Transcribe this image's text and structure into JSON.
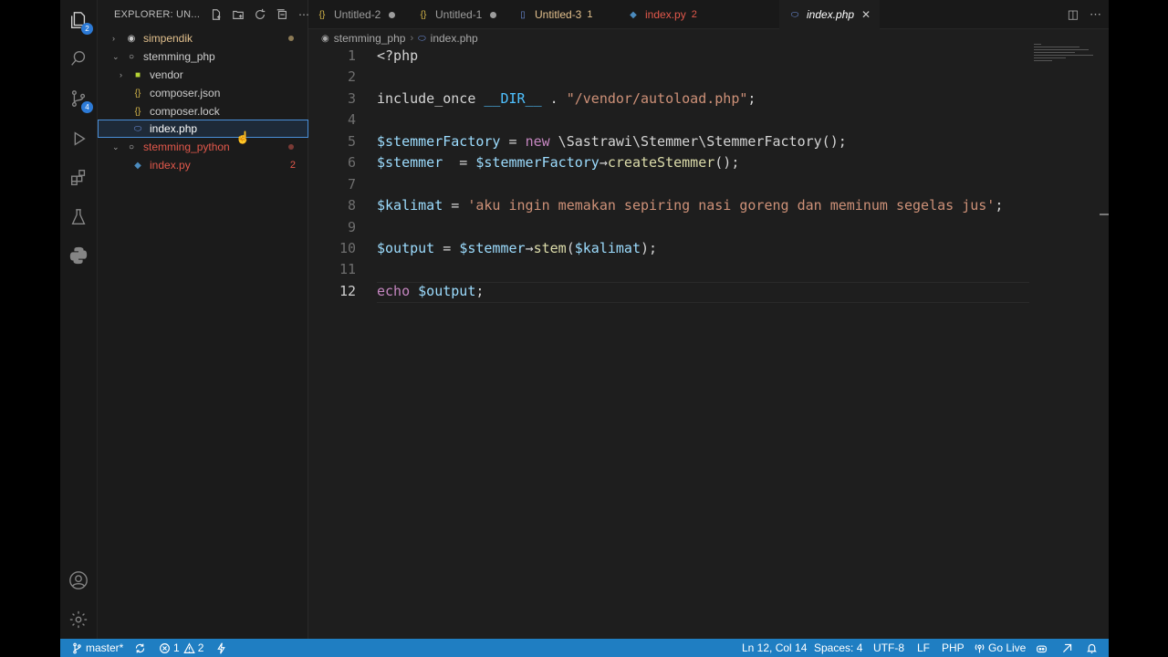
{
  "explorer": {
    "title": "EXPLORER: UN...",
    "items": [
      {
        "label": "simpendik",
        "type": "folder-root",
        "expanded": false,
        "color": "#e2c08d"
      },
      {
        "label": "stemming_php",
        "type": "folder-root",
        "expanded": true
      },
      {
        "label": "vendor",
        "type": "folder",
        "expanded": false
      },
      {
        "label": "composer.json",
        "type": "json"
      },
      {
        "label": "composer.lock",
        "type": "json"
      },
      {
        "label": "index.php",
        "type": "php",
        "selected": true
      },
      {
        "label": "stemming_python",
        "type": "folder-root",
        "expanded": true,
        "color": "#e2584b"
      },
      {
        "label": "index.py",
        "type": "python",
        "problems": "2",
        "color": "#e2584b"
      }
    ]
  },
  "tabs": [
    {
      "label": "Untitled-2",
      "icon": "json-icon",
      "modified": true
    },
    {
      "label": "Untitled-1",
      "icon": "json-icon",
      "modified": true
    },
    {
      "label": "Untitled-3",
      "count": "1",
      "icon": "file-icon",
      "color": "#e2c08d"
    },
    {
      "label": "index.py",
      "count": "2",
      "icon": "python-icon",
      "color": "#e2584b"
    },
    {
      "label": "index.php",
      "icon": "php-icon",
      "active": true
    }
  ],
  "breadcrumb": {
    "folder": "stemming_php",
    "file": "index.php"
  },
  "editor": {
    "line_numbers": [
      "1",
      "2",
      "3",
      "4",
      "5",
      "6",
      "7",
      "8",
      "9",
      "10",
      "11",
      "12"
    ],
    "current_line": "12"
  },
  "code": {
    "l1": "<?php",
    "l3a": "include_once ",
    "l3b": "__DIR__",
    "l3c": " . ",
    "l3d": "\"/vendor/autoload.php\"",
    "l3e": ";",
    "l5a": "$stemmerFactory",
    "l5b": " = ",
    "l5c": "new",
    "l5d": " \\Sastrawi\\Stemmer\\StemmerFactory();",
    "l6a": "$stemmer",
    "l6b": "  = ",
    "l6c": "$stemmerFactory",
    "l6d": "→",
    "l6e": "createStemmer",
    "l6f": "();",
    "l8a": "$kalimat",
    "l8b": " = ",
    "l8c": "'aku ingin memakan sepiring nasi goreng dan meminum segelas jus'",
    "l8d": ";",
    "l10a": "$output",
    "l10b": " = ",
    "l10c": "$stemmer",
    "l10d": "→",
    "l10e": "stem",
    "l10f": "(",
    "l10g": "$kalimat",
    "l10h": ");",
    "l12a": "echo",
    "l12b": " ",
    "l12c": "$output",
    "l12d": ";"
  },
  "status": {
    "branch": "master*",
    "errors": "1",
    "warnings": "2",
    "position": "Ln 12, Col 14",
    "spaces": "Spaces: 4",
    "encoding": "UTF-8",
    "eol": "LF",
    "language": "PHP",
    "golive": "Go Live"
  },
  "badges": {
    "explorer": "2",
    "scm": "4"
  }
}
